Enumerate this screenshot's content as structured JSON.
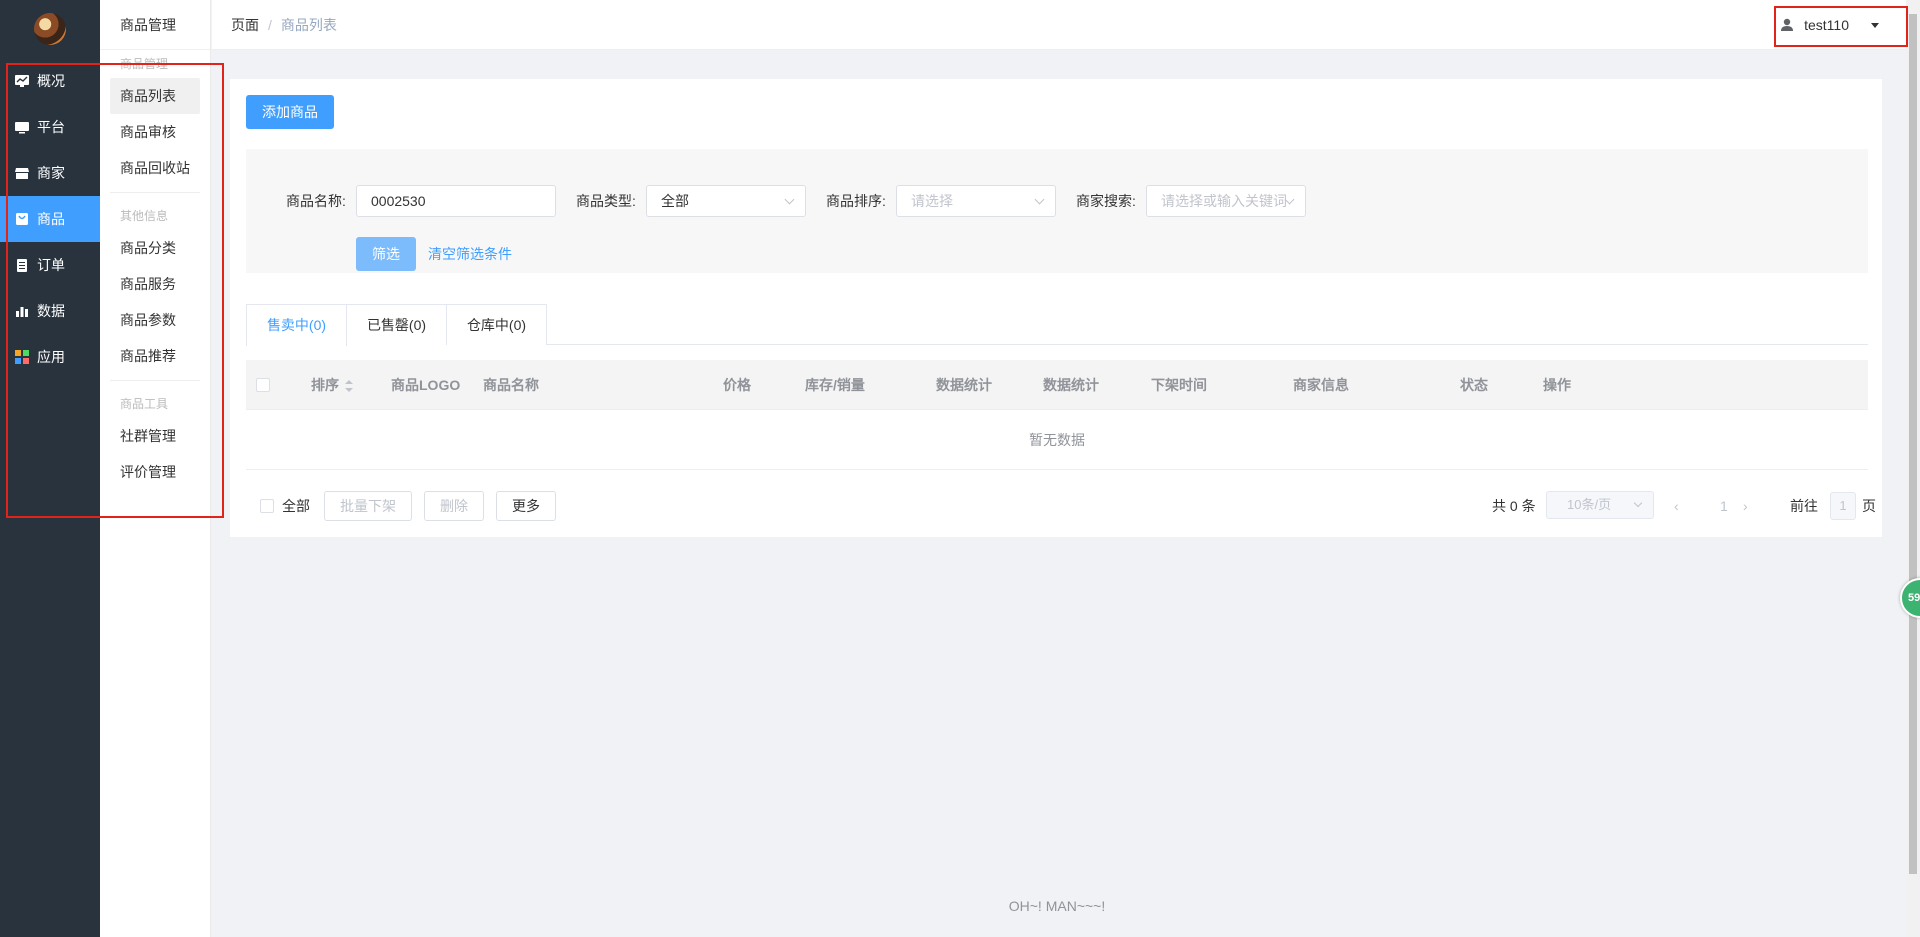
{
  "sidebar": {
    "items": [
      {
        "label": "概况",
        "icon": "monitor-chart-icon"
      },
      {
        "label": "平台",
        "icon": "desktop-icon"
      },
      {
        "label": "商家",
        "icon": "store-icon"
      },
      {
        "label": "商品",
        "icon": "shopping-bag-icon",
        "active": true
      },
      {
        "label": "订单",
        "icon": "clipboard-icon"
      },
      {
        "label": "数据",
        "icon": "bar-chart-icon"
      },
      {
        "label": "应用",
        "icon": "apps-grid-icon"
      }
    ]
  },
  "subnav": {
    "title": "商品管理",
    "group1": "商品管理",
    "group1_items": [
      "商品列表",
      "商品审核",
      "商品回收站"
    ],
    "group2": "其他信息",
    "group2_items": [
      "商品分类",
      "商品服务",
      "商品参数",
      "商品推荐"
    ],
    "group3": "商品工具",
    "group3_items": [
      "社群管理",
      "评价管理"
    ]
  },
  "header": {
    "breadcrumb_home": "页面",
    "breadcrumb_sep": "/",
    "breadcrumb_current": "商品列表",
    "username": "test110"
  },
  "toolbar": {
    "add_label": "添加商品"
  },
  "filter": {
    "name_label": "商品名称:",
    "name_value": "0002530",
    "type_label": "商品类型:",
    "type_value": "全部",
    "sort_label": "商品排序:",
    "sort_placeholder": "请选择",
    "merchant_label": "商家搜索:",
    "merchant_placeholder": "请选择或输入关键词",
    "filter_button": "筛选",
    "clear_link": "清空筛选条件"
  },
  "tabs": [
    {
      "label": "售卖中(0)",
      "active": true
    },
    {
      "label": "已售罄(0)"
    },
    {
      "label": "仓库中(0)"
    }
  ],
  "table": {
    "columns": [
      "排序",
      "商品LOGO",
      "商品名称",
      "价格",
      "库存/销量",
      "数据统计",
      "数据统计",
      "下架时间",
      "商家信息",
      "状态",
      "操作"
    ],
    "empty_text": "暂无数据"
  },
  "bulk": {
    "all_label": "全部",
    "offline_label": "批量下架",
    "delete_label": "删除",
    "more_label": "更多"
  },
  "pagination": {
    "total": "共 0 条",
    "page_size": "10条/页",
    "prev": "‹",
    "current": "1",
    "next": "›",
    "goto_label": "前往",
    "goto_value": "1",
    "goto_unit": "页"
  },
  "footer": {
    "text": "OH~! MAN~~~!"
  },
  "float_badge": "59",
  "colors": {
    "primary": "#409eff",
    "sidebar_bg": "#28333e",
    "annotation": "#e2231a"
  }
}
